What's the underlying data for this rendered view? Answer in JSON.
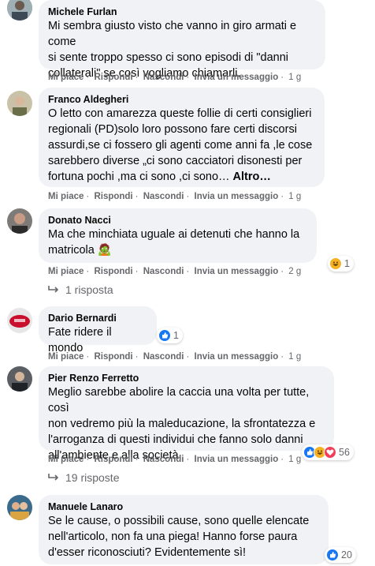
{
  "comments": [
    {
      "author": "Michele Furlan",
      "text": "Mi sembra giusto visto che vanno in giro armati e come\nsi sente troppo spesso ci sono episodi di \"danni\ncollaterali\" se così vogliamo chiamarli.",
      "actions": {
        "like": "Mi piace",
        "reply": "Rispondi",
        "hide": "Nascondi",
        "message": "Invia un messaggio",
        "time": "1 g"
      }
    },
    {
      "author": "Franco Aldegheri",
      "text": "O letto con amarezza queste follie di certi consiglieri\nregionali (PD)solo loro possono fare certi discorsi\nassurdi,se ci fossero gli agenti come anni fa ,le cose\nsarebbero diverse „ci sono cacciatori disonesti per\nfortuna pochi ,ma ci sono ,ci sono…",
      "more": "Altro…",
      "actions": {
        "like": "Mi piace",
        "reply": "Rispondi",
        "hide": "Nascondi",
        "message": "Invia un messaggio",
        "time": "1 g"
      }
    },
    {
      "author": "Donato Nacci",
      "text": "Ma che minchiata uguale ai detenuti che hanno la\nmatricola",
      "emoji": "🧟",
      "actions": {
        "like": "Mi piace",
        "reply": "Rispondi",
        "hide": "Nascondi",
        "message": "Invia un messaggio",
        "time": "2 g"
      },
      "reaction_count": "1",
      "replies": "1 risposta"
    },
    {
      "author": "Dario Bernardi",
      "text": "Fate ridere il mondo",
      "actions": {
        "like": "Mi piace",
        "reply": "Rispondi",
        "hide": "Nascondi",
        "message": "Invia un messaggio",
        "time": "1 g"
      },
      "reaction_count": "1"
    },
    {
      "author": "Pier Renzo Ferretto",
      "text": "Meglio sarebbe abolire la caccia una volta per tutte, così\nnon vedremo più la maleducazione, la sfrontatezza e\nl'arroganza di questi individui che fanno solo danni\nall'ambiente e alla società.",
      "actions": {
        "like": "Mi piace",
        "reply": "Rispondi",
        "hide": "Nascondi",
        "message": "Invia un messaggio",
        "time": "1 g"
      },
      "reaction_count": "56",
      "replies": "19 risposte"
    },
    {
      "author": "Manuele Lanaro",
      "text": "Se le cause, o possibili cause, sono quelle elencate\nnell'articolo, non fa una piega! Hanno forse paura\nd'esser riconosciuti? Evidentemente sì!",
      "reaction_count": "20"
    }
  ],
  "colors": {
    "bubble": "#f0f2f5",
    "meta": "#65676b",
    "like_blue": "#1877f2",
    "haha": "#f7b125",
    "love": "#f33e58"
  }
}
